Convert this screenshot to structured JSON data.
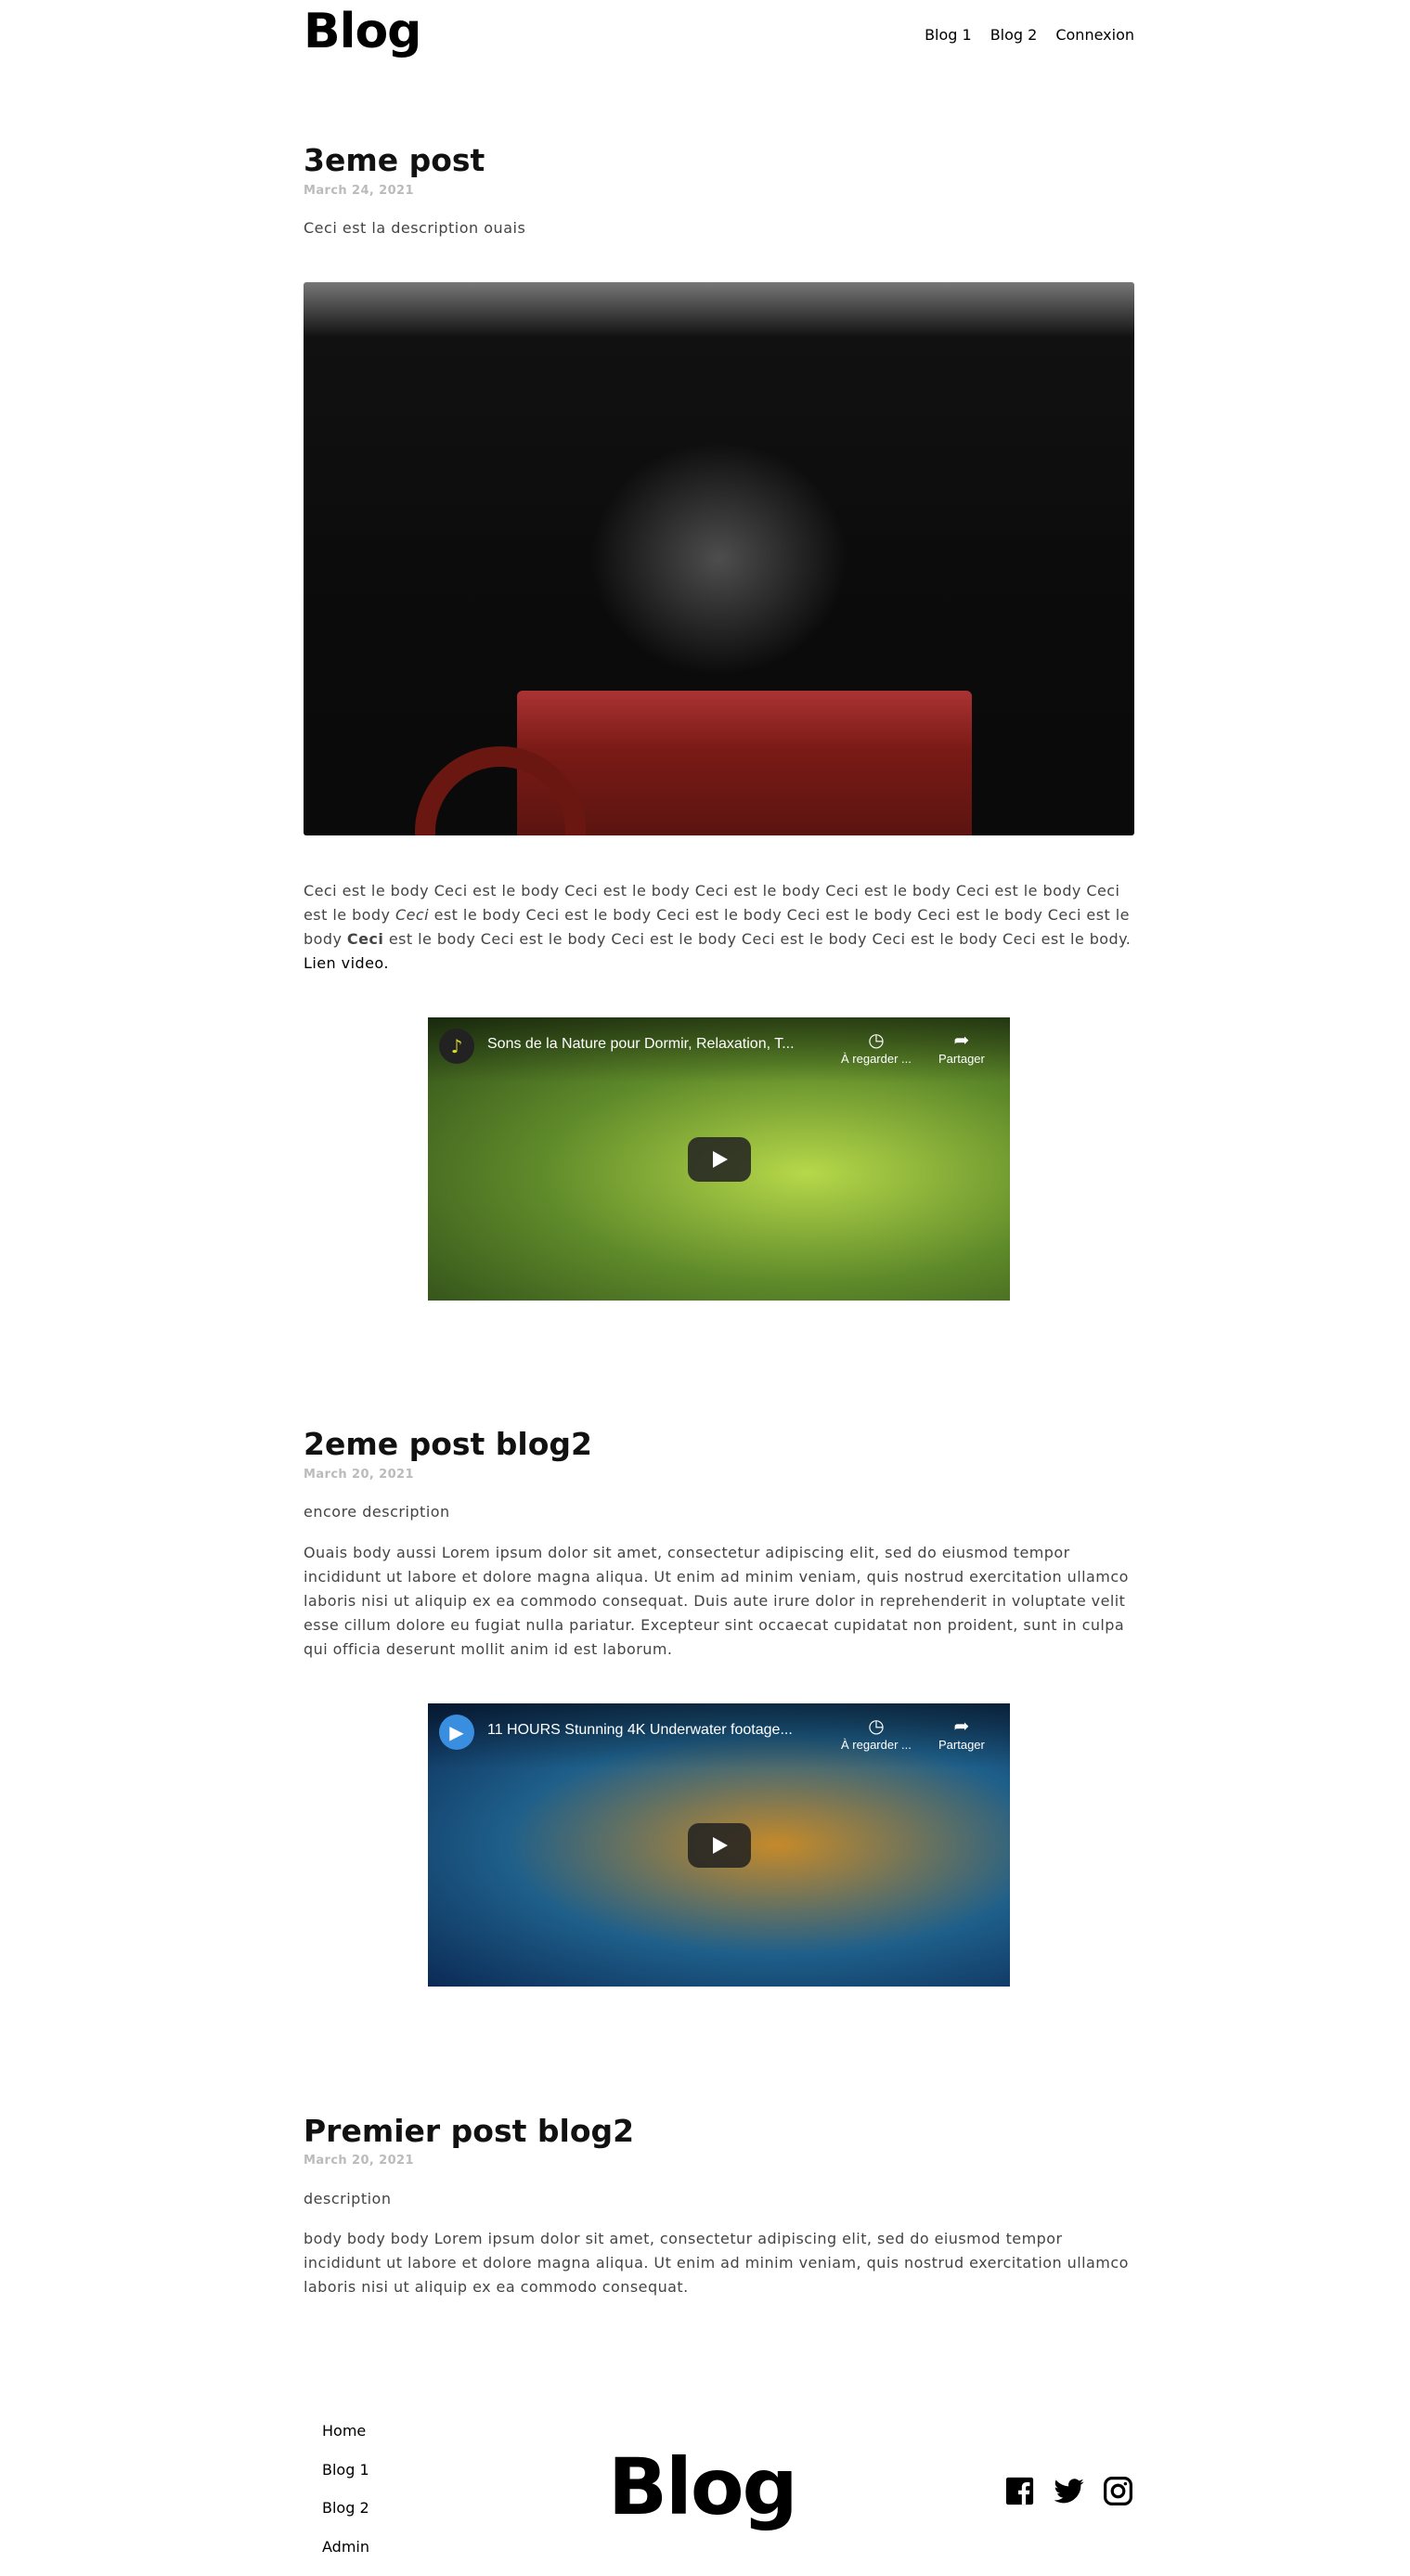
{
  "header": {
    "logo": "Blog",
    "nav": [
      "Blog 1",
      "Blog 2",
      "Connexion"
    ]
  },
  "posts": [
    {
      "title": "3eme post",
      "date": "March 24, 2021",
      "description": "Ceci est la description ouais",
      "body": [
        {
          "t": "Ceci est le body Ceci est le body Ceci est le body Ceci est le body Ceci est le body Ceci est le body Ceci est le body "
        },
        {
          "t": "Ceci",
          "style": "italic"
        },
        {
          "t": " est le body Ceci est le body Ceci est le body Ceci est le body Ceci est le body Ceci est le body "
        },
        {
          "t": "Ceci",
          "style": "bold"
        },
        {
          "t": " est le body Ceci est le body Ceci est le body Ceci est le body Ceci est le body Ceci est le body. "
        },
        {
          "t": "Lien video.",
          "style": "link"
        }
      ],
      "video": {
        "title": "Sons de la Nature pour Dormir, Relaxation, T...",
        "watch_later": "À regarder ...",
        "share": "Partager",
        "channel_icon": "music-note-icon"
      }
    },
    {
      "title": "2eme post blog2",
      "date": "March 20, 2021",
      "description": "encore description",
      "body": "Ouais body aussi Lorem ipsum dolor sit amet, consectetur adipiscing elit, sed do eiusmod tempor incididunt ut labore et dolore magna aliqua. Ut enim ad minim veniam, quis nostrud exercitation ullamco laboris nisi ut aliquip ex ea commodo consequat. Duis aute irure dolor in reprehenderit in voluptate velit esse cillum dolore eu fugiat nulla pariatur. Excepteur sint occaecat cupidatat non proident, sunt in culpa qui officia deserunt mollit anim id est laborum.",
      "video": {
        "title": "11 HOURS Stunning 4K Underwater footage...",
        "watch_later": "À regarder ...",
        "share": "Partager",
        "channel_icon": "play-channel-icon"
      }
    },
    {
      "title": "Premier post blog2",
      "date": "March 20, 2021",
      "description": "description",
      "body": "body body body Lorem ipsum dolor sit amet, consectetur adipiscing elit, sed do eiusmod tempor incididunt ut labore et dolore magna aliqua. Ut enim ad minim veniam, quis nostrud exercitation ullamco laboris nisi ut aliquip ex ea commodo consequat."
    }
  ],
  "footer": {
    "links": [
      "Home",
      "Blog 1",
      "Blog 2",
      "Admin"
    ],
    "logo": "Blog",
    "social": [
      "facebook-icon",
      "twitter-icon",
      "instagram-icon"
    ]
  }
}
